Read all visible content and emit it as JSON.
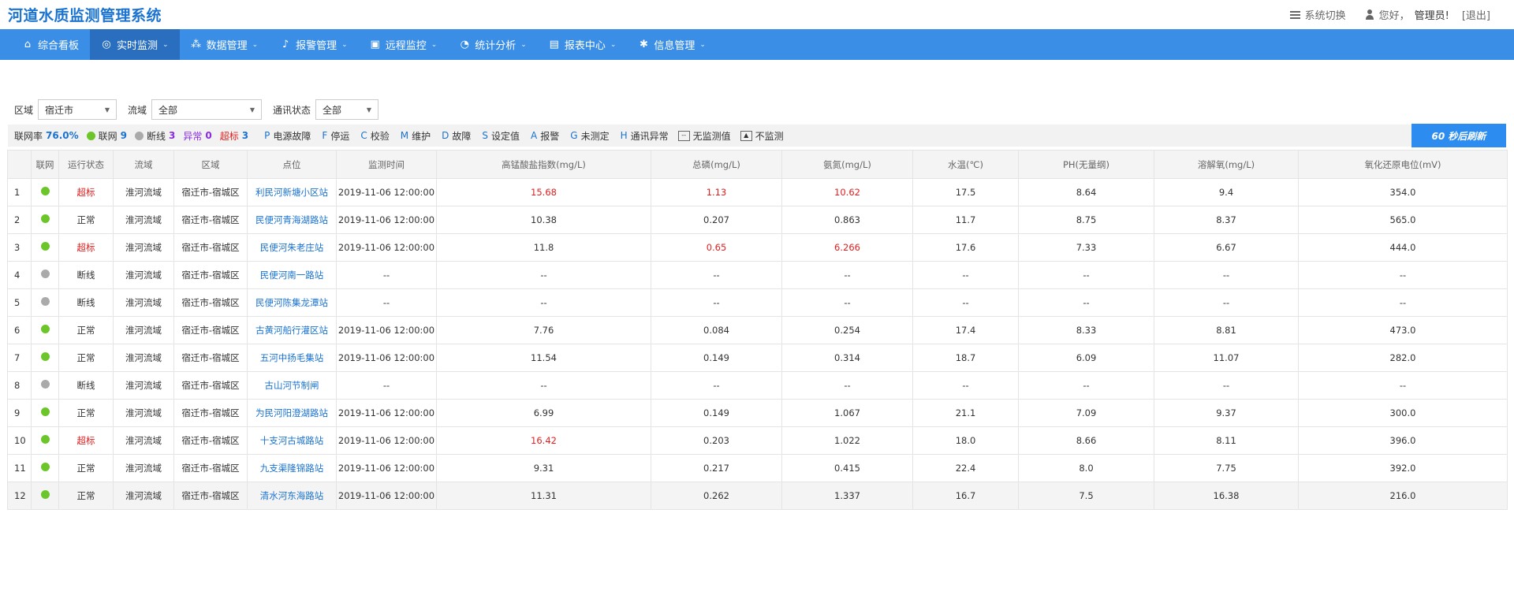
{
  "header": {
    "title": "河道水质监测管理系统",
    "switch_label": "系统切换",
    "greeting": "您好，",
    "user_name": "管理员!",
    "logout": "[退出]"
  },
  "nav": [
    {
      "label": "综合看板",
      "icon": "home-icon",
      "glyph": "⌂",
      "dropdown": false
    },
    {
      "label": "实时监测",
      "icon": "globe-icon",
      "glyph": "◎",
      "dropdown": true
    },
    {
      "label": "数据管理",
      "icon": "share-icon",
      "glyph": "⁂",
      "dropdown": true
    },
    {
      "label": "报警管理",
      "icon": "bell-icon",
      "glyph": "♪",
      "dropdown": true
    },
    {
      "label": "远程监控",
      "icon": "monitor-icon",
      "glyph": "▣",
      "dropdown": true
    },
    {
      "label": "统计分析",
      "icon": "pie-chart-icon",
      "glyph": "◔",
      "dropdown": true
    },
    {
      "label": "报表中心",
      "icon": "report-icon",
      "glyph": "▤",
      "dropdown": true
    },
    {
      "label": "信息管理",
      "icon": "gear-icon",
      "glyph": "✱",
      "dropdown": true
    }
  ],
  "filters": {
    "region_label": "区域",
    "region_value": "宿迁市",
    "basin_label": "流域",
    "basin_value": "全部",
    "comm_label": "通讯状态",
    "comm_value": "全部"
  },
  "legend": {
    "online_rate_label": "联网率",
    "online_rate": "76.0%",
    "online_label": "联网",
    "online_count": "9",
    "offline_label": "断线",
    "offline_count": "3",
    "abnormal_label": "异常",
    "abnormal_count": "0",
    "over_label": "超标",
    "over_count": "3",
    "codes": [
      {
        "code": "P",
        "desc": "电源故障"
      },
      {
        "code": "F",
        "desc": "停运"
      },
      {
        "code": "C",
        "desc": "校验"
      },
      {
        "code": "M",
        "desc": "维护"
      },
      {
        "code": "D",
        "desc": "故障"
      },
      {
        "code": "S",
        "desc": "设定值"
      },
      {
        "code": "A",
        "desc": "报警"
      },
      {
        "code": "G",
        "desc": "未测定"
      },
      {
        "code": "H",
        "desc": "通讯异常"
      }
    ],
    "no_value_icon": "--",
    "no_value_label": "无监测值",
    "no_monitor_icon": "▲",
    "no_monitor_label": "不监测",
    "refresh_label": "60 秒后刷新"
  },
  "table": {
    "headers": [
      "",
      "联网",
      "运行状态",
      "流域",
      "区域",
      "点位",
      "监测时间",
      "高锰酸盐指数(mg/L)",
      "总磷(mg/L)",
      "氨氮(mg/L)",
      "水温(℃)",
      "PH(无量纲)",
      "溶解氧(mg/L)",
      "氧化还原电位(mV)"
    ],
    "colors": {
      "online": "#6cc62a",
      "offline": "#aaaaaa",
      "over": "#e02020"
    },
    "rows": [
      {
        "idx": "1",
        "online": true,
        "status": "超标",
        "status_over": true,
        "basin": "淮河流域",
        "region": "宿迁市-宿城区",
        "site": "利民河新塘小区站",
        "time": "2019-11-06 12:00:00",
        "vals": [
          "15.68",
          "1.13",
          "10.62",
          "17.5",
          "8.64",
          "9.4",
          "354.0"
        ],
        "red": [
          true,
          true,
          true,
          false,
          false,
          false,
          false
        ]
      },
      {
        "idx": "2",
        "online": true,
        "status": "正常",
        "status_over": false,
        "basin": "淮河流域",
        "region": "宿迁市-宿城区",
        "site": "民便河青海湖路站",
        "time": "2019-11-06 12:00:00",
        "vals": [
          "10.38",
          "0.207",
          "0.863",
          "11.7",
          "8.75",
          "8.37",
          "565.0"
        ],
        "red": [
          false,
          false,
          false,
          false,
          false,
          false,
          false
        ]
      },
      {
        "idx": "3",
        "online": true,
        "status": "超标",
        "status_over": true,
        "basin": "淮河流域",
        "region": "宿迁市-宿城区",
        "site": "民便河朱老庄站",
        "time": "2019-11-06 12:00:00",
        "vals": [
          "11.8",
          "0.65",
          "6.266",
          "17.6",
          "7.33",
          "6.67",
          "444.0"
        ],
        "red": [
          false,
          true,
          true,
          false,
          false,
          false,
          false
        ]
      },
      {
        "idx": "4",
        "online": false,
        "status": "断线",
        "status_over": false,
        "basin": "淮河流域",
        "region": "宿迁市-宿城区",
        "site": "民便河南一路站",
        "time": "--",
        "vals": [
          "--",
          "--",
          "--",
          "--",
          "--",
          "--",
          "--"
        ],
        "red": [
          false,
          false,
          false,
          false,
          false,
          false,
          false
        ]
      },
      {
        "idx": "5",
        "online": false,
        "status": "断线",
        "status_over": false,
        "basin": "淮河流域",
        "region": "宿迁市-宿城区",
        "site": "民便河陈集龙潭站",
        "time": "--",
        "vals": [
          "--",
          "--",
          "--",
          "--",
          "--",
          "--",
          "--"
        ],
        "red": [
          false,
          false,
          false,
          false,
          false,
          false,
          false
        ]
      },
      {
        "idx": "6",
        "online": true,
        "status": "正常",
        "status_over": false,
        "basin": "淮河流域",
        "region": "宿迁市-宿城区",
        "site": "古黄河船行灌区站",
        "time": "2019-11-06 12:00:00",
        "vals": [
          "7.76",
          "0.084",
          "0.254",
          "17.4",
          "8.33",
          "8.81",
          "473.0"
        ],
        "red": [
          false,
          false,
          false,
          false,
          false,
          false,
          false
        ]
      },
      {
        "idx": "7",
        "online": true,
        "status": "正常",
        "status_over": false,
        "basin": "淮河流域",
        "region": "宿迁市-宿城区",
        "site": "五河中扬毛集站",
        "time": "2019-11-06 12:00:00",
        "vals": [
          "11.54",
          "0.149",
          "0.314",
          "18.7",
          "6.09",
          "11.07",
          "282.0"
        ],
        "red": [
          false,
          false,
          false,
          false,
          false,
          false,
          false
        ]
      },
      {
        "idx": "8",
        "online": false,
        "status": "断线",
        "status_over": false,
        "basin": "淮河流域",
        "region": "宿迁市-宿城区",
        "site": "古山河节制闸",
        "time": "--",
        "vals": [
          "--",
          "--",
          "--",
          "--",
          "--",
          "--",
          "--"
        ],
        "red": [
          false,
          false,
          false,
          false,
          false,
          false,
          false
        ]
      },
      {
        "idx": "9",
        "online": true,
        "status": "正常",
        "status_over": false,
        "basin": "淮河流域",
        "region": "宿迁市-宿城区",
        "site": "为民河阳澄湖路站",
        "time": "2019-11-06 12:00:00",
        "vals": [
          "6.99",
          "0.149",
          "1.067",
          "21.1",
          "7.09",
          "9.37",
          "300.0"
        ],
        "red": [
          false,
          false,
          false,
          false,
          false,
          false,
          false
        ]
      },
      {
        "idx": "10",
        "online": true,
        "status": "超标",
        "status_over": true,
        "basin": "淮河流域",
        "region": "宿迁市-宿城区",
        "site": "十支河古城路站",
        "time": "2019-11-06 12:00:00",
        "vals": [
          "16.42",
          "0.203",
          "1.022",
          "18.0",
          "8.66",
          "8.11",
          "396.0"
        ],
        "red": [
          true,
          false,
          false,
          false,
          false,
          false,
          false
        ]
      },
      {
        "idx": "11",
        "online": true,
        "status": "正常",
        "status_over": false,
        "basin": "淮河流域",
        "region": "宿迁市-宿城区",
        "site": "九支渠隆锦路站",
        "time": "2019-11-06 12:00:00",
        "vals": [
          "9.31",
          "0.217",
          "0.415",
          "22.4",
          "8.0",
          "7.75",
          "392.0"
        ],
        "red": [
          false,
          false,
          false,
          false,
          false,
          false,
          false
        ]
      },
      {
        "idx": "12",
        "online": true,
        "status": "正常",
        "status_over": false,
        "basin": "淮河流域",
        "region": "宿迁市-宿城区",
        "site": "清水河东海路站",
        "time": "2019-11-06 12:00:00",
        "vals": [
          "11.31",
          "0.262",
          "1.337",
          "16.7",
          "7.5",
          "16.38",
          "216.0"
        ],
        "red": [
          false,
          false,
          false,
          false,
          false,
          false,
          false
        ]
      }
    ]
  }
}
